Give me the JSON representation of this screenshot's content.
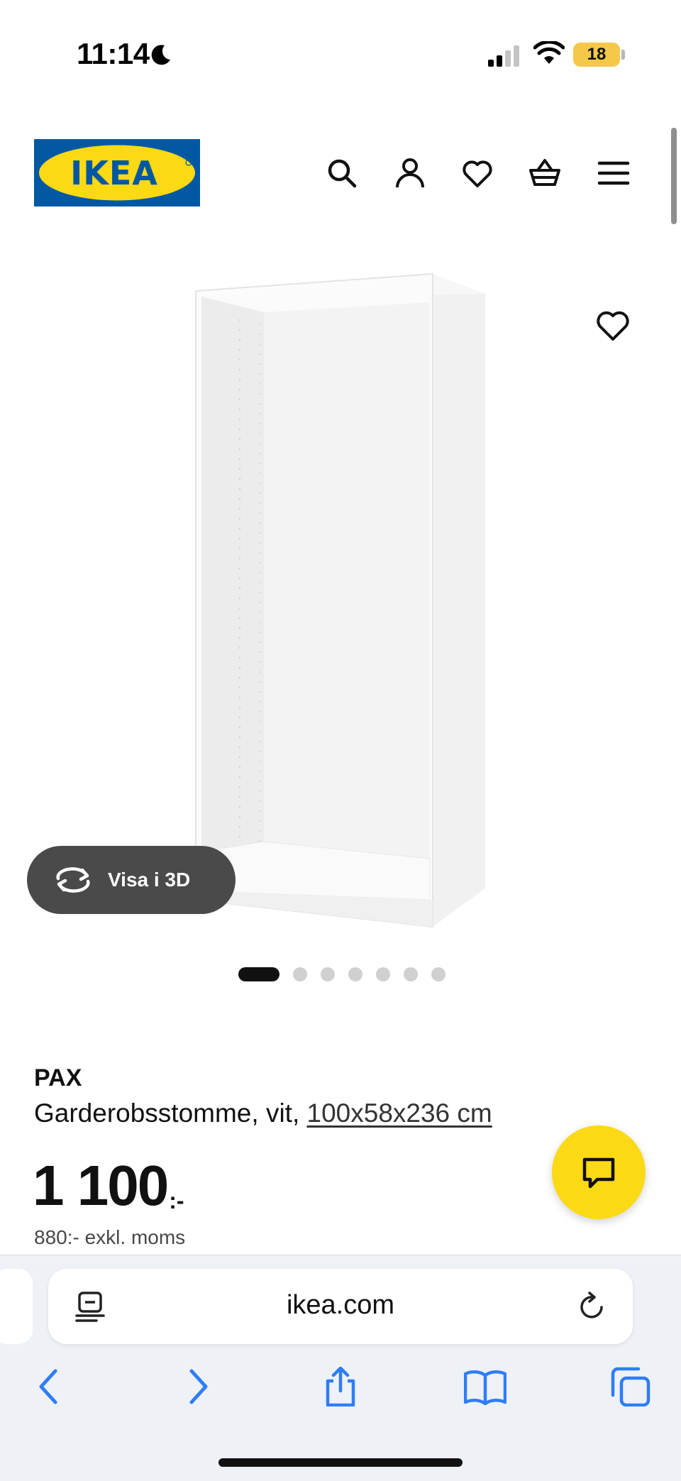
{
  "status_bar": {
    "time": "11:14",
    "battery": "18"
  },
  "header": {
    "logo_text": "IKEA",
    "icons": [
      "search-icon",
      "account-icon",
      "heart-icon",
      "basket-icon",
      "menu-icon"
    ]
  },
  "gallery": {
    "view_3d_label": "Visa i 3D",
    "image_count": 7,
    "active_index": 0
  },
  "product": {
    "name": "PAX",
    "description": "Garderobsstomme, vit, ",
    "measurement": "100x58x236 cm",
    "price": "1 100",
    "price_suffix": ":-",
    "price_ex_vat": "880:- exkl. moms"
  },
  "browser": {
    "address": "ikea.com"
  },
  "colors": {
    "ikea_blue": "#0058a3",
    "ikea_yellow": "#fbd914",
    "safari_blue": "#2f7df6"
  }
}
